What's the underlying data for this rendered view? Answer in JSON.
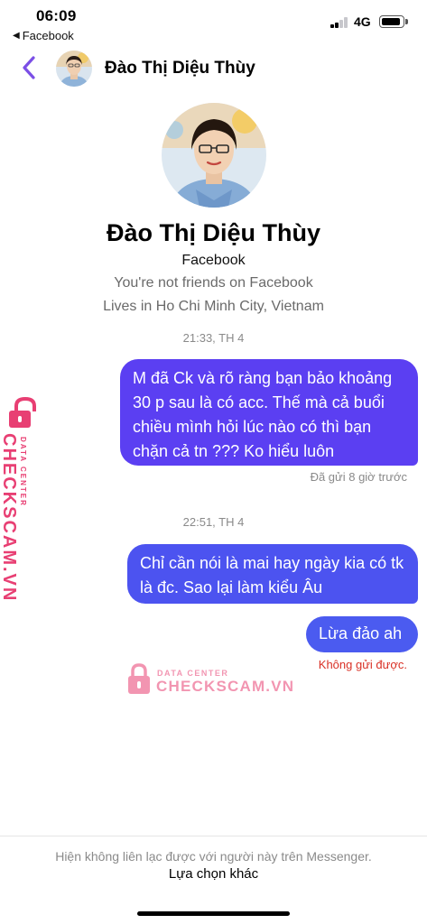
{
  "status_bar": {
    "time": "06:09",
    "back_app": "Facebook",
    "network": "4G",
    "signal_bars_active": 2,
    "signal_bars_total": 4
  },
  "header": {
    "contact_name": "Đào Thị Diệu Thùy"
  },
  "profile": {
    "name": "Đào Thị Diệu Thùy",
    "source": "Facebook",
    "friendship": "You're not friends on Facebook",
    "location": "Lives in Ho Chi Minh City, Vietnam"
  },
  "messages": [
    {
      "timestamp": "21:33, TH 4",
      "text": "M đã Ck và rõ ràng bạn bảo khoảng 30 p sau là có acc. Thế mà cả buổi chiều mình hỏi lúc nào có thì bạn chặn cả tn ??? Ko hiểu luôn",
      "status": "Đã gửi 8 giờ trước"
    },
    {
      "timestamp": "22:51, TH 4",
      "text": "Chỉ cần nói là mai hay ngày kia có tk là đc. Sao lại làm kiểu Âu"
    },
    {
      "text": "Lừa đảo ah",
      "status": "Không gửi được."
    }
  ],
  "watermark": {
    "small": "DATA CENTER",
    "big": "CHECKSCAM.VN"
  },
  "footer": {
    "note": "Hiện không liên lạc được với người này trên Messenger.",
    "action": "Lựa chọn khác"
  },
  "colors": {
    "accent": "#7b4fe6",
    "bubble_1": "#5b3ff2",
    "bubble_2": "#4c53f0",
    "bubble_3": "#4b5bf0",
    "error": "#d93025",
    "watermark": "#e83f73"
  },
  "icons": {
    "back": "chevron-left-icon",
    "lock": "lock-icon"
  }
}
